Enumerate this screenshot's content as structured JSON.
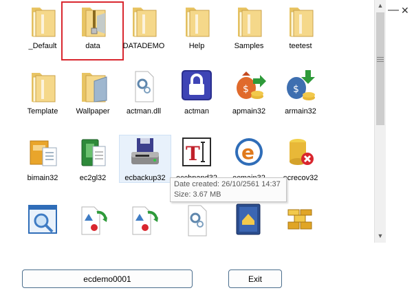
{
  "colors": {
    "accent_selection": "#d9262e",
    "folder": "#f5d88a",
    "tooltip_text": "#575757"
  },
  "window": {
    "minimize_glyph": "—",
    "close_glyph": "✕"
  },
  "items": [
    {
      "label": "_Default",
      "icon": "folder-icon"
    },
    {
      "label": "data",
      "icon": "zip-folder-icon"
    },
    {
      "label": "DATADEMO",
      "icon": "folder-icon"
    },
    {
      "label": "Help",
      "icon": "folder-icon"
    },
    {
      "label": "Samples",
      "icon": "folder-icon"
    },
    {
      "label": "teetest",
      "icon": "folder-icon"
    },
    {
      "label": "Template",
      "icon": "folder-icon"
    },
    {
      "label": "Wallpaper",
      "icon": "folder-image-icon"
    },
    {
      "label": "actman.dll",
      "icon": "dll-gear-icon"
    },
    {
      "label": "actman",
      "icon": "padlock-icon"
    },
    {
      "label": "apmain32",
      "icon": "money-bag-arrow-icon"
    },
    {
      "label": "armain32",
      "icon": "money-bag-down-arrow-icon"
    },
    {
      "label": "bimain32",
      "icon": "box-document-icon"
    },
    {
      "label": "ec2gl32",
      "icon": "green-binder-icon"
    },
    {
      "label": "ecbackup32",
      "icon": "floppy-drive-icon"
    },
    {
      "label": "ecchpand32",
      "icon": "text-cursor-icon"
    },
    {
      "label": "ecmain32",
      "icon": "blue-e-icon"
    },
    {
      "label": "ecrecov32",
      "icon": "database-error-icon"
    },
    {
      "label": "",
      "icon": "magnifier-window-icon"
    },
    {
      "label": "",
      "icon": "shapes-refresh-icon"
    },
    {
      "label": "",
      "icon": "shapes-refresh-icon"
    },
    {
      "label": "",
      "icon": "dll-gear-icon"
    },
    {
      "label": "",
      "icon": "blue-book-icon"
    },
    {
      "label": "",
      "icon": "gold-bars-icon"
    }
  ],
  "tooltip": {
    "line1": "Date created: 26/10/2561 14:37",
    "line2": "Size: 3.67 MB"
  },
  "buttons": {
    "company": "ecdemo0001",
    "exit": "Exit"
  }
}
